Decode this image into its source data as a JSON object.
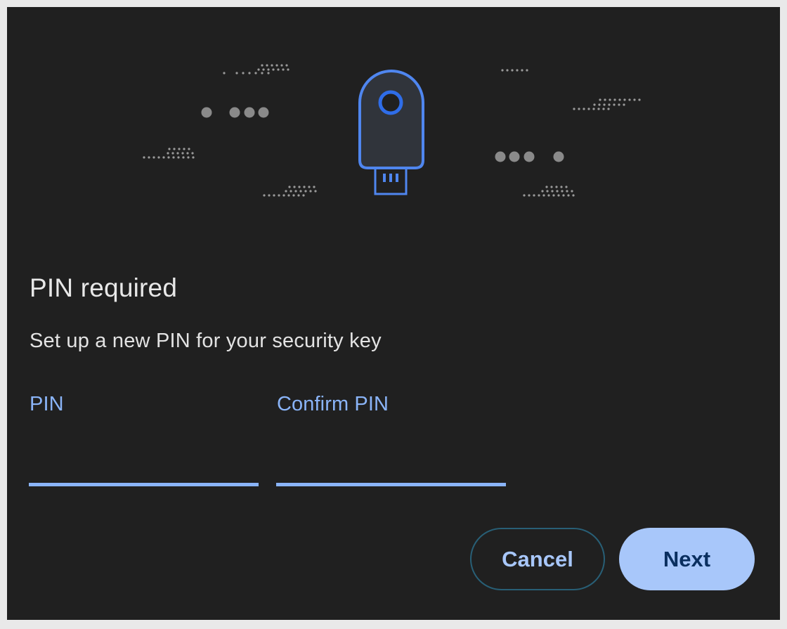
{
  "dialog": {
    "illustration_icon": "security-key-icon",
    "title": "PIN required",
    "description": "Set up a new PIN for your security key",
    "fields": {
      "pin": {
        "label": "PIN",
        "value": "",
        "placeholder": ""
      },
      "confirm_pin": {
        "label": "Confirm PIN",
        "value": "",
        "placeholder": ""
      }
    },
    "buttons": {
      "cancel_label": "Cancel",
      "next_label": "Next"
    }
  },
  "colors": {
    "background": "#202020",
    "text_primary": "#e8e8e8",
    "accent_blue": "#8ab4f8",
    "button_primary_bg": "#a8c7fa",
    "button_primary_text": "#0a2f5f",
    "button_secondary_border": "#285f76"
  }
}
